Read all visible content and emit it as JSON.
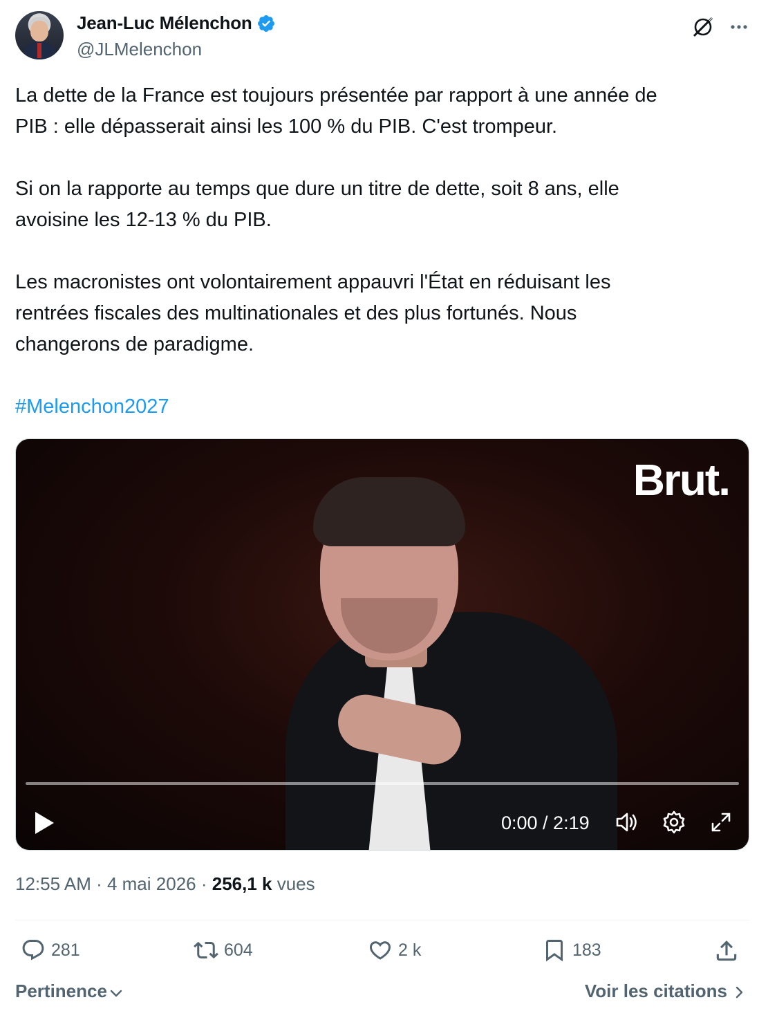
{
  "author": {
    "name": "Jean-Luc Mélenchon",
    "handle": "@JLMelenchon",
    "verified_color": "#1d9bf0"
  },
  "tweet": {
    "paragraphs": [
      [
        "La dette de la France est toujours présentée par rapport à une année de",
        "PIB : elle dépasserait ainsi les 100 % du PIB. C'est trompeur."
      ],
      [
        "Si on la rapporte au temps que dure un titre de dette, soit 8 ans, elle",
        "avoisine les 12-13 % du PIB."
      ],
      [
        "Les macronistes ont volontairement appauvri l'État en réduisant les",
        "rentrées fiscales des multinationales et des plus fortunés. Nous",
        "changerons de paradigme."
      ]
    ],
    "hashtag": "#Melenchon2027"
  },
  "video": {
    "brand": "Brut.",
    "time": "0:00 / 2:19",
    "progress": 0
  },
  "meta": {
    "time": "12:55 AM",
    "sep1": " · ",
    "date": "4 mai 2026",
    "sep2": " · ",
    "views_count": "256,1 k",
    "views_label": " vues"
  },
  "actions": {
    "replies": "281",
    "retweets": "604",
    "likes": "2 k",
    "bookmarks": "183"
  },
  "footer": {
    "sort_label": "Pertinence",
    "quotes_label": "Voir les citations"
  },
  "icons": {
    "header": [
      "grok-icon",
      "more-icon"
    ],
    "video": [
      "play-icon",
      "volume-icon",
      "settings-icon",
      "fullscreen-icon"
    ],
    "actions": [
      "reply-icon",
      "retweet-icon",
      "like-icon",
      "bookmark-icon",
      "share-icon"
    ]
  }
}
